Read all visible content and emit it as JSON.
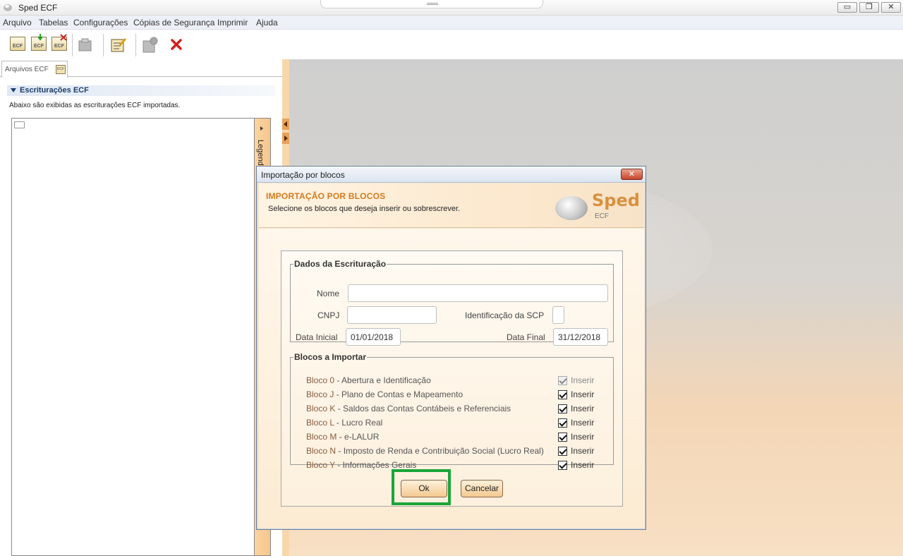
{
  "window": {
    "title": "Sped ECF",
    "buttons": [
      "▭",
      "❐",
      "✕"
    ]
  },
  "menu": [
    "Arquivo",
    "Tabelas",
    "Configurações",
    "Cópias de Segurança",
    "Imprimir",
    "Ajuda"
  ],
  "toolbar": {
    "icon_text": "ECF",
    "icons": [
      "ecf-open-icon",
      "ecf-import-icon",
      "ecf-delete-icon",
      "folder-icon",
      "edit-icon",
      "validate-icon",
      "close-red-icon"
    ]
  },
  "left_panel": {
    "tab_label": "Arquivos ECF",
    "tab_icon_text": "ECF",
    "section_title": "Escriturações ECF",
    "section_desc": "Abaixo são exibidas as escriturações ECF importadas.",
    "legend_label": "Legenda"
  },
  "dialog": {
    "title": "Importação por blocos",
    "close": "✕",
    "header_title": "IMPORTAÇÃO POR BLOCOS",
    "header_sub": "Selecione os blocos que deseja inserir ou sobrescrever.",
    "logo_text": "Sped",
    "logo_sub": "ECF",
    "dados": {
      "legend": "Dados da Escrituração",
      "nome_label": "Nome",
      "nome_value": "",
      "cnpj_label": "CNPJ",
      "cnpj_value": "",
      "scp_label": "Identificação da SCP",
      "scp_value": "",
      "data_inicial_label": "Data Inicial",
      "data_inicial_value": "01/01/2018",
      "data_final_label": "Data Final",
      "data_final_value": "31/12/2018"
    },
    "blocos": {
      "legend": "Blocos a Importar",
      "insert_label": "Inserir",
      "items": [
        {
          "code": "Bloco 0",
          "name": " - Abertura e Identificação",
          "checked": true,
          "disabled": true
        },
        {
          "code": "Bloco J",
          "name": " - Plano de Contas e Mapeamento",
          "checked": true,
          "disabled": false
        },
        {
          "code": "Bloco K",
          "name": " - Saldos das Contas Contábeis e Referenciais",
          "checked": true,
          "disabled": false
        },
        {
          "code": "Bloco L",
          "name": " - Lucro Real",
          "checked": true,
          "disabled": false
        },
        {
          "code": "Bloco M",
          "name": " - e-LALUR",
          "checked": true,
          "disabled": false
        },
        {
          "code": "Bloco N",
          "name": " - Imposto de Renda e Contribuição Social (Lucro Real)",
          "checked": true,
          "disabled": false
        },
        {
          "code": "Bloco Y",
          "name": " - Informações Gerais",
          "checked": true,
          "disabled": false
        }
      ]
    },
    "ok_label": "Ok",
    "cancel_label": "Cancelar"
  },
  "colors": {
    "highlight": "#1aa53a",
    "header_title": "#d47a1e",
    "bloco_code": "#8a5c3c"
  }
}
